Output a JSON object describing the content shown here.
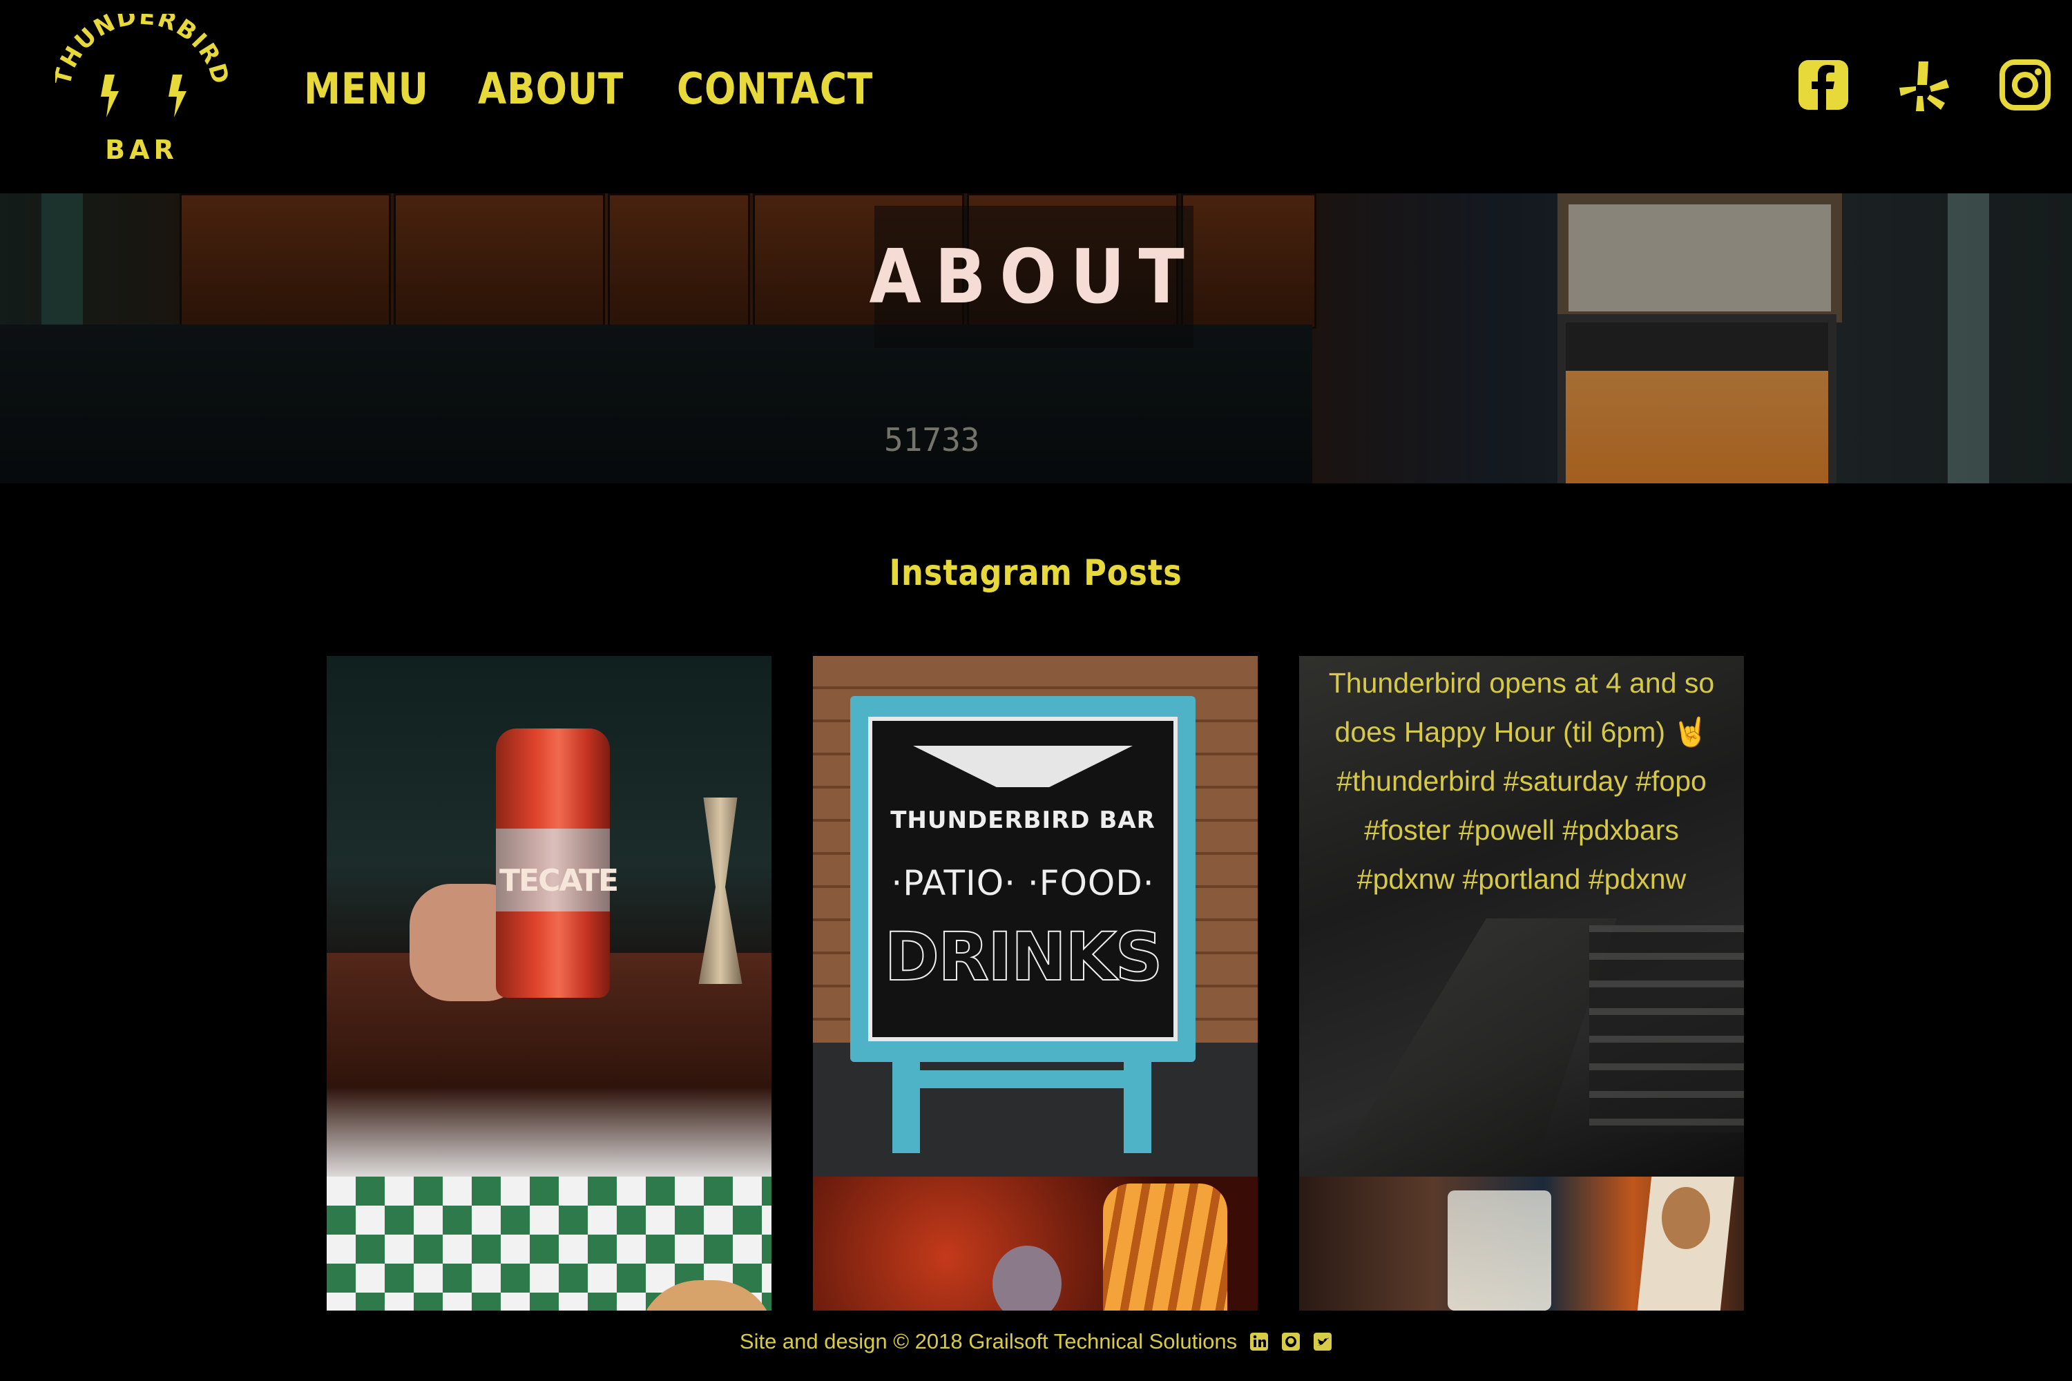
{
  "brand": {
    "logo_top": "THUNDERBIRD",
    "logo_bottom": "BAR",
    "accent": "#e8d93a"
  },
  "nav": {
    "items": [
      {
        "label": "Menu"
      },
      {
        "label": "About"
      },
      {
        "label": "Contact"
      }
    ]
  },
  "social": [
    {
      "icon": "facebook-icon"
    },
    {
      "icon": "yelp-icon"
    },
    {
      "icon": "instagram-icon"
    }
  ],
  "hero": {
    "title": "ABOUT",
    "plate_number": "51733"
  },
  "instagram": {
    "title": "Instagram Posts",
    "posts": [
      {
        "text": "TECATE"
      },
      {
        "lines": [
          "THUNDERBIRD BAR",
          "·PATIO· ·FOOD·",
          "DRINKS"
        ]
      },
      {
        "caption": "Thunderbird opens at 4 and so does Happy Hour (til 6pm) 🤘 #thunderbird #saturday #fopo #foster #powell #pdxbars #pdxnw #portland #pdxnw"
      },
      {
        "text": ""
      },
      {
        "text": ""
      },
      {
        "text": ""
      }
    ]
  },
  "footer": {
    "text": "Site and design © 2018 Grailsoft Technical Solutions",
    "icons": [
      "linkedin-icon",
      "github-icon",
      "twitter-icon"
    ]
  }
}
